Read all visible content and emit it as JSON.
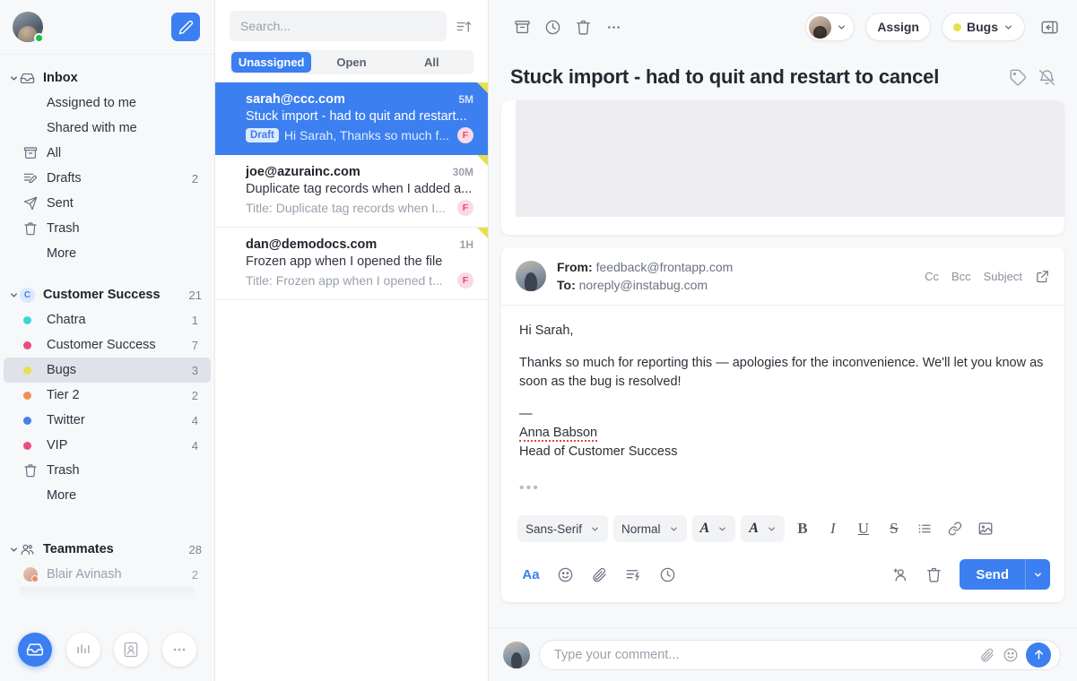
{
  "sidebar": {
    "compose_title": "Compose",
    "sections": [
      {
        "name": "inbox",
        "label": "Inbox",
        "icon": "inbox-icon",
        "count": "",
        "items": [
          {
            "label": "Assigned to me",
            "icon": "",
            "count": ""
          },
          {
            "label": "Shared with me",
            "icon": "",
            "count": ""
          },
          {
            "label": "All",
            "icon": "archive-icon",
            "count": ""
          },
          {
            "label": "Drafts",
            "icon": "drafts-icon",
            "count": "2"
          },
          {
            "label": "Sent",
            "icon": "send-icon",
            "count": ""
          },
          {
            "label": "Trash",
            "icon": "trash-icon",
            "count": ""
          },
          {
            "label": "More",
            "icon": "",
            "count": ""
          }
        ]
      },
      {
        "name": "customer-success",
        "label": "Customer Success",
        "icon": "team-avatar-c",
        "count": "21",
        "items": [
          {
            "label": "Chatra",
            "icon": "dot",
            "color": "#3ed6d0",
            "count": "1"
          },
          {
            "label": "Customer Success",
            "icon": "dot",
            "color": "#ea4d7f",
            "count": "7"
          },
          {
            "label": "Bugs",
            "icon": "dot",
            "color": "#e8e04a",
            "count": "3",
            "selected": true
          },
          {
            "label": "Tier 2",
            "icon": "dot",
            "color": "#ef8e55",
            "count": "2"
          },
          {
            "label": "Twitter",
            "icon": "dot",
            "color": "#4a7fe8",
            "count": "4"
          },
          {
            "label": "VIP",
            "icon": "dot",
            "color": "#ea4d7f",
            "count": "4"
          },
          {
            "label": "Trash",
            "icon": "trash-icon",
            "count": ""
          },
          {
            "label": "More",
            "icon": "",
            "count": ""
          }
        ]
      },
      {
        "name": "teammates",
        "label": "Teammates",
        "icon": "people-icon",
        "count": "28",
        "items": [
          {
            "label": "Blair Avinash",
            "icon": "teammate-avatar",
            "count": "2"
          }
        ]
      }
    ],
    "bottom_nav": [
      {
        "name": "inbox-nav-icon",
        "active": true
      },
      {
        "name": "analytics-nav-icon",
        "active": false
      },
      {
        "name": "contacts-nav-icon",
        "active": false
      },
      {
        "name": "more-nav-icon",
        "active": false
      }
    ]
  },
  "list": {
    "search_placeholder": "Search...",
    "sort_icon": "sort-ascending-icon",
    "tabs": [
      {
        "label": "Unassigned",
        "active": true
      },
      {
        "label": "Open",
        "active": false
      },
      {
        "label": "All",
        "active": false
      }
    ],
    "messages": [
      {
        "from": "sarah@ccc.com",
        "time": "5M",
        "subject": "Stuck import - had to quit and restart...",
        "badge": "Draft",
        "preview": "Hi Sarah, Thanks so much f...",
        "channel": "F",
        "selected": true,
        "flagged": true
      },
      {
        "from": "joe@azurainc.com",
        "time": "30M",
        "subject": "Duplicate tag records when I added a...",
        "badge": "",
        "preview": "Title: Duplicate tag records when I...",
        "channel": "F",
        "selected": false,
        "flagged": true
      },
      {
        "from": "dan@demodocs.com",
        "time": "1H",
        "subject": "Frozen app when I opened the file",
        "badge": "",
        "preview": "Title: Frozen app when I opened t...",
        "channel": "F",
        "selected": false,
        "flagged": true
      }
    ]
  },
  "main": {
    "toolbar": {
      "archive_icon": "archive-icon",
      "snooze_icon": "clock-icon",
      "trash_icon": "trash-icon",
      "more_icon": "more-horizontal-icon",
      "assign_label": "Assign",
      "tag_label": "Bugs",
      "tag_color": "#e8e04a",
      "panel_icon": "toggle-panel-icon"
    },
    "title": "Stuck import - had to quit and restart to cancel",
    "title_icons": [
      {
        "name": "tag-icon"
      },
      {
        "name": "bell-off-icon"
      }
    ],
    "compose": {
      "from_label": "From:",
      "from_value": "feedback@frontapp.com",
      "to_label": "To:",
      "to_value": "noreply@instabug.com",
      "cc_label": "Cc",
      "bcc_label": "Bcc",
      "subject_label": "Subject",
      "popout_icon": "pop-out-icon",
      "body": {
        "greeting": "Hi Sarah,",
        "paragraph": "Thanks so much for reporting this — apologies for the inconvenience. We'll let you know as soon as the bug is resolved!",
        "separator": "—",
        "signature_name": "Anna Babson",
        "signature_title": "Head of Customer Success",
        "more_dots": "•••"
      },
      "format_bar": {
        "font_family": "Sans-Serif",
        "text_style": "Normal",
        "text_color_icon": "text-color-icon",
        "highlight_icon": "text-highlight-icon",
        "bold": "B",
        "italic": "I",
        "underline": "U",
        "strikethrough": "S",
        "list_icon": "bullet-list-icon",
        "link_icon": "link-icon",
        "image_icon": "image-icon"
      },
      "action_bar": {
        "formatting_label": "Aa",
        "emoji_icon": "emoji-icon",
        "attach_icon": "paperclip-icon",
        "template_icon": "canned-response-icon",
        "schedule_icon": "clock-icon",
        "add_person_icon": "add-person-icon",
        "discard_icon": "trash-icon",
        "send_label": "Send",
        "send_caret_icon": "chevron-down-icon"
      }
    },
    "comment": {
      "placeholder": "Type your comment...",
      "attach_icon": "paperclip-icon",
      "emoji_icon": "emoji-icon",
      "send_icon": "arrow-up-icon"
    }
  }
}
